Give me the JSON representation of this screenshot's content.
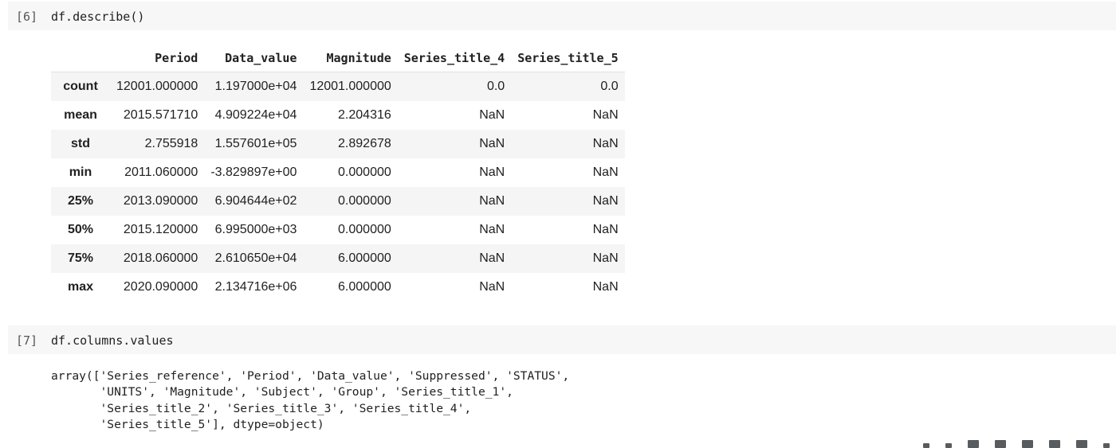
{
  "cells": [
    {
      "exec_count": "[6]",
      "code": "df.describe()"
    },
    {
      "exec_count": "[7]",
      "code": "df.columns.values"
    }
  ],
  "describe_table": {
    "columns": [
      "",
      "Period",
      "Data_value",
      "Magnitude",
      "Series_title_4",
      "Series_title_5"
    ],
    "rows": [
      [
        "count",
        "12001.000000",
        "1.197000e+04",
        "12001.000000",
        "0.0",
        "0.0"
      ],
      [
        "mean",
        "2015.571710",
        "4.909224e+04",
        "2.204316",
        "NaN",
        "NaN"
      ],
      [
        "std",
        "2.755918",
        "1.557601e+05",
        "2.892678",
        "NaN",
        "NaN"
      ],
      [
        "min",
        "2011.060000",
        "-3.829897e+00",
        "0.000000",
        "NaN",
        "NaN"
      ],
      [
        "25%",
        "2013.090000",
        "6.904644e+02",
        "0.000000",
        "NaN",
        "NaN"
      ],
      [
        "50%",
        "2015.120000",
        "6.995000e+03",
        "0.000000",
        "NaN",
        "NaN"
      ],
      [
        "75%",
        "2018.060000",
        "2.610650e+04",
        "6.000000",
        "NaN",
        "NaN"
      ],
      [
        "max",
        "2020.090000",
        "2.134716e+06",
        "6.000000",
        "NaN",
        "NaN"
      ]
    ]
  },
  "columns_output": {
    "lines": [
      "array(['Series_reference', 'Period', 'Data_value', 'Suppressed', 'STATUS',",
      "       'UNITS', 'Magnitude', 'Subject', 'Group', 'Series_title_1',",
      "       'Series_title_2', 'Series_title_3', 'Series_title_4',",
      "       'Series_title_5'], dtype=object)"
    ]
  },
  "toolbar": {
    "icons": [
      "move-up-icon",
      "move-down-icon",
      "link-icon",
      "comment-icon",
      "settings-icon",
      "mirror-cell-icon",
      "delete-icon",
      "more-icon"
    ]
  }
}
